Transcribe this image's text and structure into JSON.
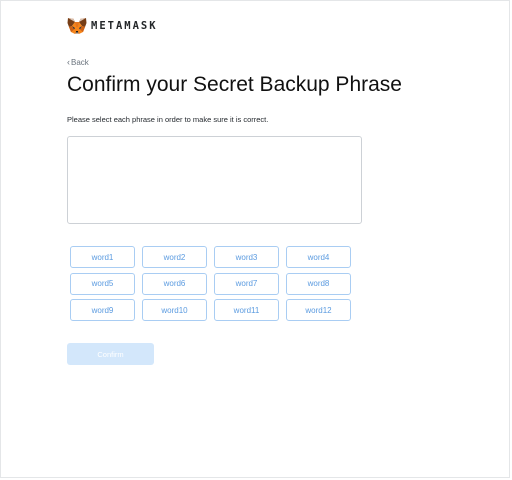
{
  "brand": {
    "name": "METAMASK",
    "logo_icon": "metamask-fox-icon"
  },
  "nav": {
    "back_label": "Back",
    "back_icon": "chevron-left-icon"
  },
  "main": {
    "title": "Confirm your Secret Backup Phrase",
    "subtitle": "Please select each phrase in order to make sure it is correct.",
    "phrase_box_value": ""
  },
  "words": [
    "word1",
    "word2",
    "word3",
    "word4",
    "word5",
    "word6",
    "word7",
    "word8",
    "word9",
    "word10",
    "word11",
    "word12"
  ],
  "actions": {
    "confirm_label": "Confirm",
    "confirm_enabled": false
  },
  "colors": {
    "accent": "#5b9be0",
    "accent_border": "#a9cdf3",
    "disabled_button": "#d3e7fb",
    "fox_orange": "#e2761b"
  }
}
